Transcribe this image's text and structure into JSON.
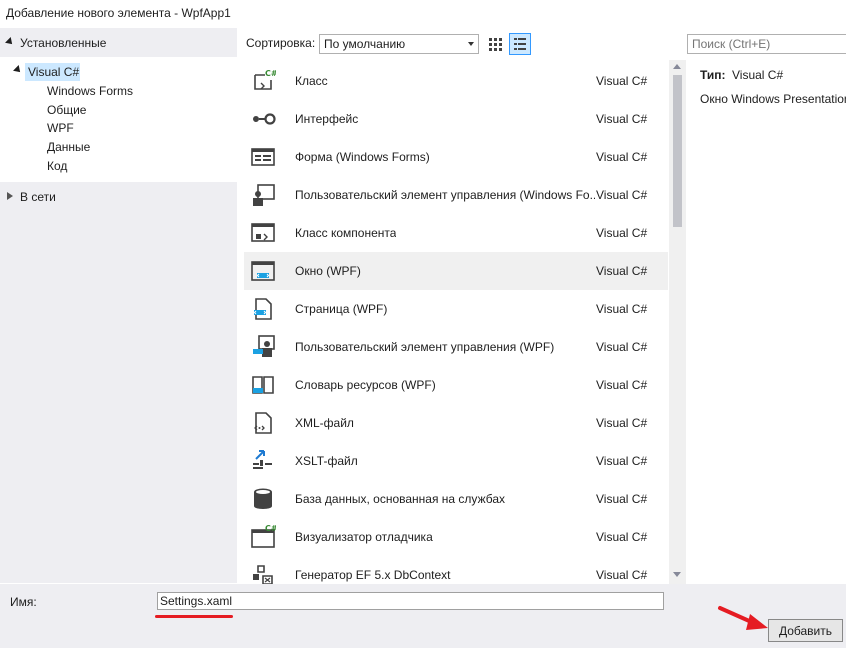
{
  "window": {
    "title": "Добавление нового элемента  - WpfApp1"
  },
  "sidebar": {
    "installed_header": "Установленные",
    "tree": [
      {
        "label": "Visual C#",
        "selected": true
      },
      {
        "label": "Windows Forms"
      },
      {
        "label": "Общие"
      },
      {
        "label": "WPF"
      },
      {
        "label": "Данные"
      },
      {
        "label": "Код"
      }
    ],
    "online_header": "В сети"
  },
  "toolbar": {
    "sort_label": "Сортировка:",
    "sort_value": "По умолчанию",
    "search_placeholder": "Поиск (Ctrl+E)"
  },
  "templates": [
    {
      "name": "Класс",
      "lang": "Visual C#",
      "icon": "class-icon"
    },
    {
      "name": "Интерфейс",
      "lang": "Visual C#",
      "icon": "interface-icon"
    },
    {
      "name": "Форма (Windows Forms)",
      "lang": "Visual C#",
      "icon": "form-icon"
    },
    {
      "name": "Пользовательский элемент управления (Windows Fo...",
      "lang": "Visual C#",
      "icon": "user-control-icon"
    },
    {
      "name": "Класс компонента",
      "lang": "Visual C#",
      "icon": "component-class-icon"
    },
    {
      "name": "Окно (WPF)",
      "lang": "Visual C#",
      "icon": "wpf-window-icon",
      "highlighted": true
    },
    {
      "name": "Страница (WPF)",
      "lang": "Visual C#",
      "icon": "wpf-page-icon"
    },
    {
      "name": "Пользовательский элемент управления (WPF)",
      "lang": "Visual C#",
      "icon": "wpf-user-control-icon"
    },
    {
      "name": "Словарь ресурсов (WPF)",
      "lang": "Visual C#",
      "icon": "resource-dictionary-icon"
    },
    {
      "name": "XML-файл",
      "lang": "Visual C#",
      "icon": "xml-file-icon"
    },
    {
      "name": "XSLT-файл",
      "lang": "Visual C#",
      "icon": "xslt-file-icon"
    },
    {
      "name": "База данных, основанная на службах",
      "lang": "Visual C#",
      "icon": "database-icon"
    },
    {
      "name": "Визуализатор отладчика",
      "lang": "Visual C#",
      "icon": "debugger-visualizer-icon"
    },
    {
      "name": "Генератор EF 5.x DbContext",
      "lang": "Visual C#",
      "icon": "ef-generator-icon"
    }
  ],
  "details": {
    "type_label": "Тип:",
    "type_value": "Visual C#",
    "description": "Окно Windows Presentation Foundation"
  },
  "bottom": {
    "name_label": "Имя:",
    "name_value": "Settings.xaml",
    "add_button": "Добавить"
  },
  "colors": {
    "accent": "#3399ff",
    "annotation_red": "#e51c23",
    "csharp_green": "#388a34"
  }
}
